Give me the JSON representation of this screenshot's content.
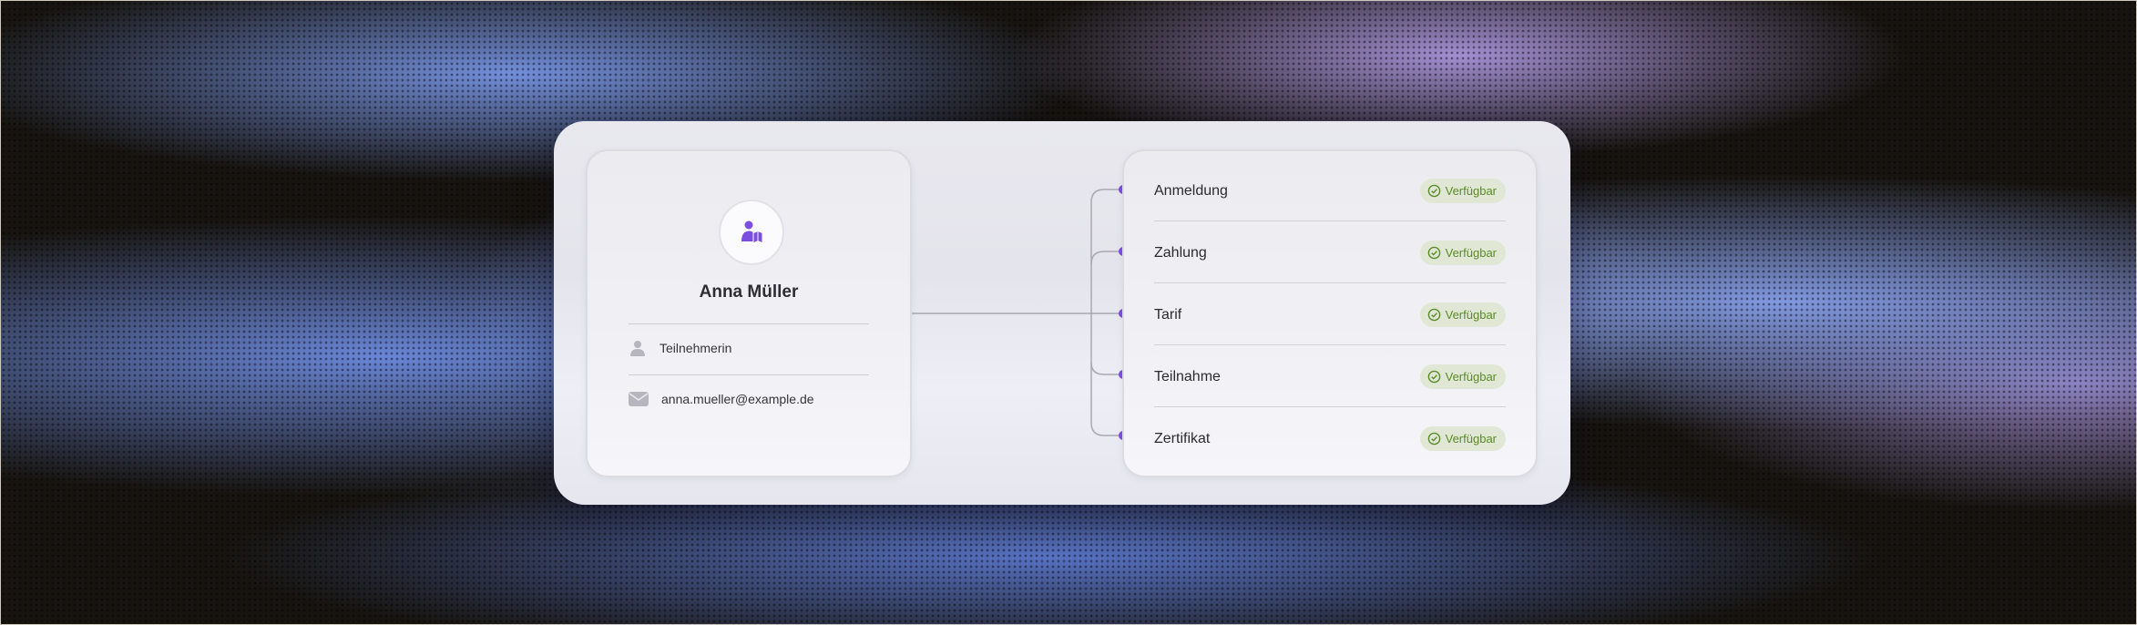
{
  "profile": {
    "name": "Anna Müller",
    "role": "Teilnehmerin",
    "email": "anna.mueller@example.de",
    "avatar_icon": "user-book-icon",
    "role_icon": "person-icon",
    "email_icon": "envelope-icon"
  },
  "steps": [
    {
      "label": "Anmeldung",
      "status": "Verfügbar"
    },
    {
      "label": "Zahlung",
      "status": "Verfügbar"
    },
    {
      "label": "Tarif",
      "status": "Verfügbar"
    },
    {
      "label": "Teilnahme",
      "status": "Verfügbar"
    },
    {
      "label": "Zertifikat",
      "status": "Verfügbar"
    }
  ],
  "colors": {
    "accent": "#7b4ee0",
    "status_text": "#5c8a2a",
    "status_bg": "#e0e7d5"
  }
}
